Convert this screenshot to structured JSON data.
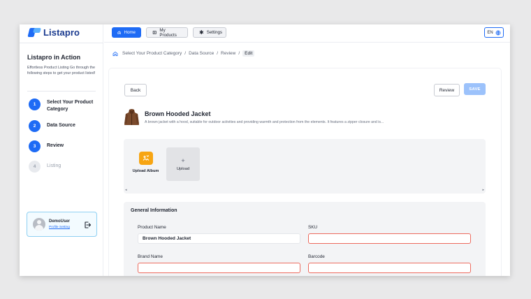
{
  "app": {
    "name": "Listapro"
  },
  "nav": {
    "home": "Home",
    "products": "My Products",
    "settings": "Settings",
    "lang": "EN"
  },
  "sidebar": {
    "title": "Listapro in Action",
    "description": "Effortless Product Listing Go through the following steps to get your product listed!",
    "steps": [
      {
        "num": "1",
        "label": "Select Your Product Category",
        "state": "done"
      },
      {
        "num": "2",
        "label": "Data Source",
        "state": "done"
      },
      {
        "num": "3",
        "label": "Review",
        "state": "done"
      },
      {
        "num": "4",
        "label": "Listing",
        "state": "pending"
      }
    ],
    "user": {
      "name": "DemoUser",
      "link": "Profile Setting"
    }
  },
  "breadcrumb": [
    "Select Your Product Category",
    "Data Source",
    "Review",
    "Edit"
  ],
  "toolbar": {
    "back": "Back",
    "review": "Review",
    "save": "SAVE"
  },
  "product": {
    "name": "Brown Hooded Jacket",
    "description": "A brown jacket with a hood, suitable for outdoor activities and providing warmth and protection from the elements. It features a zipper closure and is..."
  },
  "album": {
    "upload_album": "Upload Album",
    "upload": "Upload",
    "plus": "+"
  },
  "general": {
    "title": "General Information",
    "fields": {
      "product_name": {
        "label": "Product Name",
        "value": "Brown Hooded Jacket"
      },
      "sku": {
        "label": "SKU",
        "value": ""
      },
      "brand_name": {
        "label": "Brand Name",
        "value": ""
      },
      "barcode": {
        "label": "Barcode",
        "value": ""
      }
    }
  },
  "colors": {
    "primary": "#1e6bf5",
    "error": "#ec6a5e",
    "album_icon": "#f7a513",
    "save_disabled": "#9cc2fb"
  }
}
